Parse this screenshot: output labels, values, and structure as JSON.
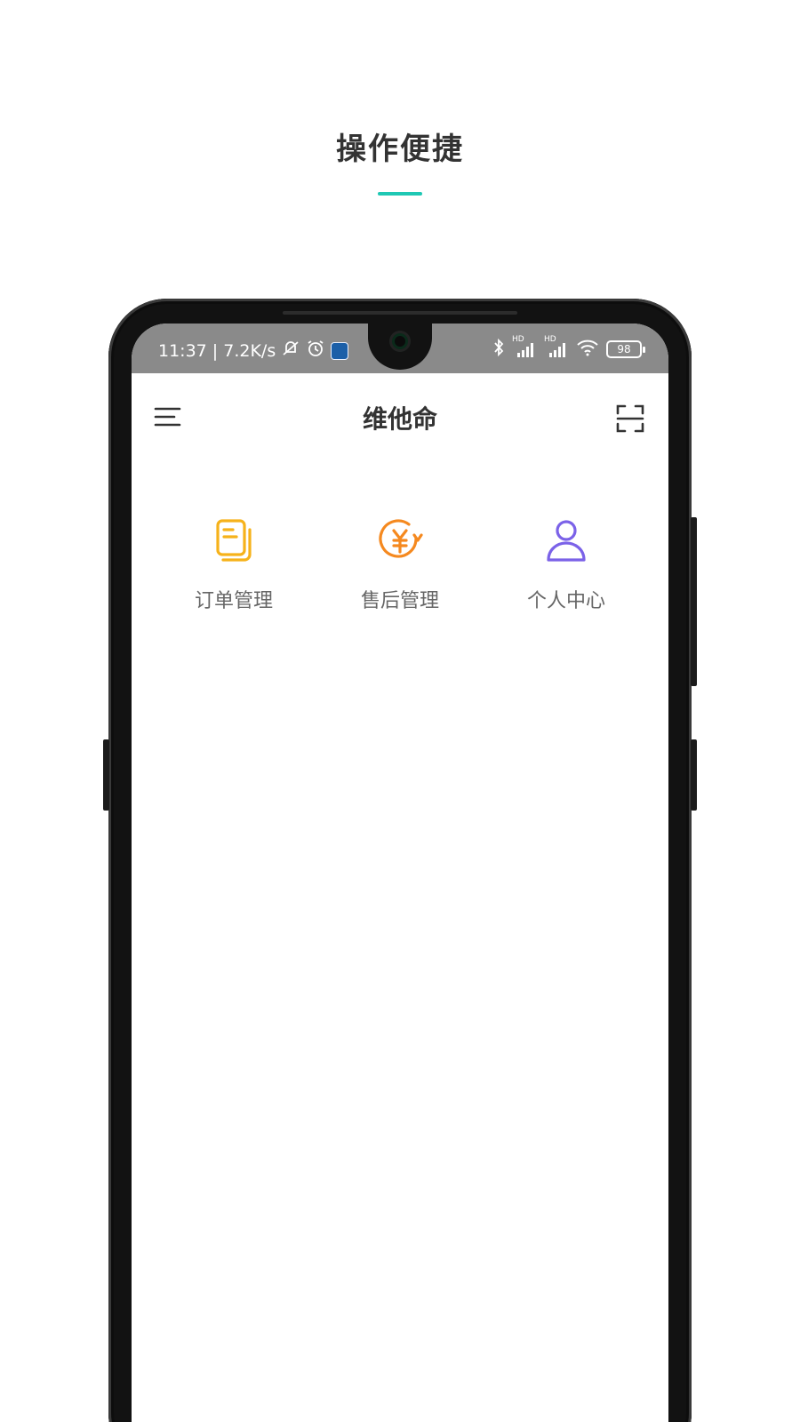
{
  "promo": {
    "title": "操作便捷",
    "accent": "#1fc8b4"
  },
  "status_bar": {
    "left_text": "11:37 | 7.2K/s",
    "signal_1": "HD",
    "signal_2": "HD",
    "battery": "98"
  },
  "header": {
    "title": "维他命",
    "menu_icon": "menu-icon",
    "scan_icon": "scan-icon"
  },
  "menu": {
    "items": [
      {
        "label": "订单管理",
        "icon": "document-icon",
        "color": "#f6b21a"
      },
      {
        "label": "售后管理",
        "icon": "yuan-refund-icon",
        "color": "#f5891f"
      },
      {
        "label": "个人中心",
        "icon": "user-icon",
        "color": "#7b62e8"
      }
    ]
  }
}
